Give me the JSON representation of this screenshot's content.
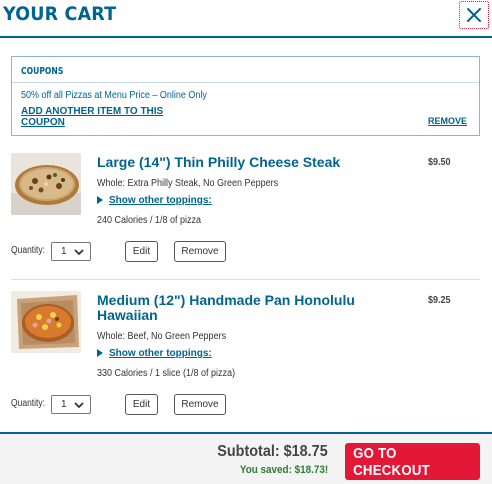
{
  "header": {
    "title": "YOUR CART",
    "close_icon": "close-icon"
  },
  "coupon": {
    "heading": "COUPONS",
    "description": "50% off all Pizzas at Menu Price – Online Only",
    "add_link": "ADD ANOTHER ITEM TO THIS COUPON",
    "remove_link": "REMOVE"
  },
  "items": [
    {
      "name": "Large (14\") Thin Philly Cheese Steak",
      "price": "$9.50",
      "detail": "Whole: Extra Philly Steak, No Green Peppers",
      "toggle": "Show other toppings:",
      "calories": "240 Calories / 1/8 of pizza",
      "quantity_label": "Quantity:",
      "quantity": "1",
      "edit": "Edit",
      "remove": "Remove"
    },
    {
      "name": "Medium (12\") Handmade Pan Honolulu Hawaiian",
      "price": "$9.25",
      "detail": "Whole: Beef, No Green Peppers",
      "toggle": "Show other toppings:",
      "calories": "330 Calories / 1 slice (1/8 of pizza)",
      "quantity_label": "Quantity:",
      "quantity": "1",
      "edit": "Edit",
      "remove": "Remove"
    }
  ],
  "footer": {
    "subtotal": "Subtotal: $18.75",
    "saved": "You saved: $18.73!",
    "checkout": "GO TO CHECKOUT"
  },
  "colors": {
    "brand_blue": "#006491",
    "checkout_red": "#e31837",
    "savings_green": "#2e7d32"
  }
}
